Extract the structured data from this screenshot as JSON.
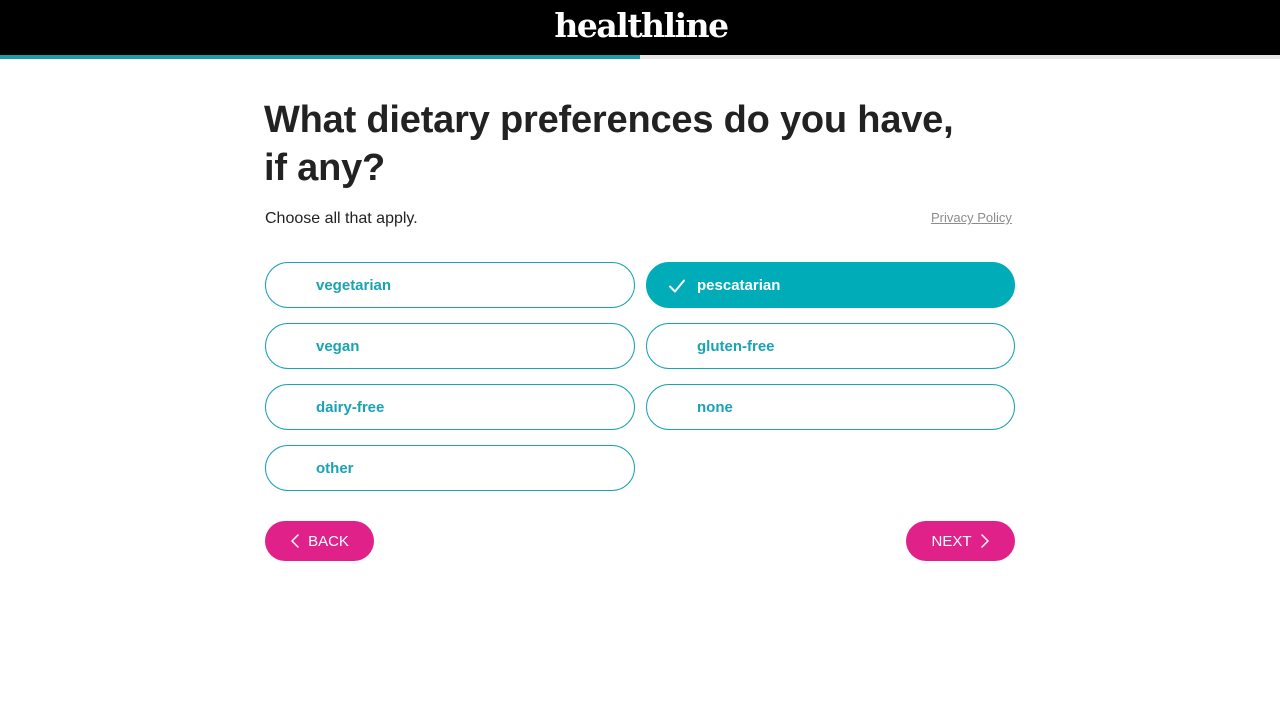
{
  "header": {
    "logo_text": "healthline",
    "logo_icon": "healthline-wordmark",
    "background": "#000000"
  },
  "progress": {
    "fraction": 0.5,
    "fill_color": "#1d9cac"
  },
  "question": {
    "title": "What dietary preferences do you have, if any?",
    "subtitle": "Choose all that apply.",
    "privacy_link": "Privacy Policy"
  },
  "options": [
    {
      "label": "vegetarian",
      "selected": false
    },
    {
      "label": "pescatarian",
      "selected": true
    },
    {
      "label": "vegan",
      "selected": false
    },
    {
      "label": "gluten-free",
      "selected": false
    },
    {
      "label": "dairy-free",
      "selected": false
    },
    {
      "label": "none",
      "selected": false
    },
    {
      "label": "other",
      "selected": false
    }
  ],
  "nav": {
    "back_label": "BACK",
    "back_icon": "chevron-left-icon",
    "next_label": "NEXT",
    "next_icon": "chevron-right-icon"
  },
  "colors": {
    "accent": "#00acb8",
    "button": "#e0218a",
    "text": "#222222"
  }
}
